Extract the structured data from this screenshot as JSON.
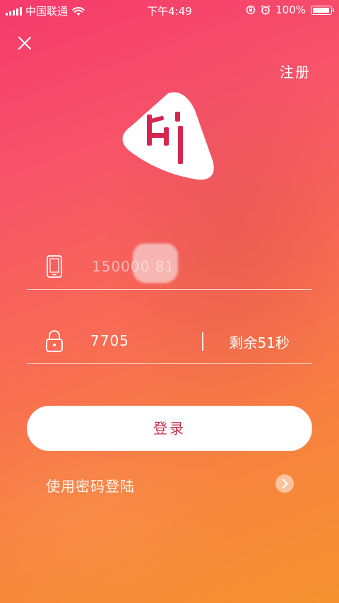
{
  "status_bar": {
    "carrier": "中国联通",
    "time": "下午4:49",
    "battery_percent": "100%",
    "battery_level": 1.0
  },
  "header": {
    "register_label": "注册"
  },
  "form": {
    "phone_value": "150000  81",
    "code_value": "7705",
    "countdown": "剩余51秒"
  },
  "actions": {
    "login_label": "登录",
    "password_login_label": "使用密码登陆"
  },
  "colors": {
    "accent": "#c8314e",
    "gradient_top": "#f53a6c",
    "gradient_bottom": "#f59230"
  },
  "icons": [
    "signal-icon",
    "wifi-icon",
    "lock-rotation-icon",
    "alarm-icon",
    "battery-icon",
    "close-icon",
    "hi-logo",
    "phone-icon",
    "lock-icon",
    "chevron-right-icon"
  ]
}
